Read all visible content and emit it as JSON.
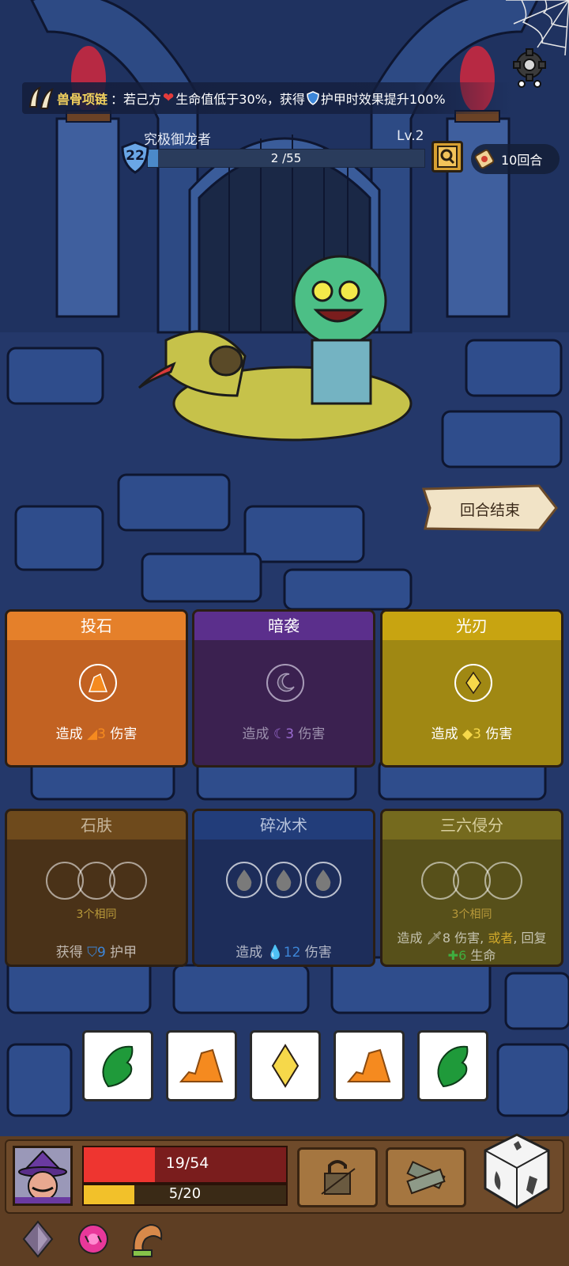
{
  "relic_banner": {
    "name": "兽骨项链",
    "sep": "：",
    "t1": "若己方",
    "t2": "生命值低于30%，获得",
    "t3": "护甲时效果提升100%"
  },
  "player": {
    "title": "究极御龙者",
    "level_label": "Lv.2",
    "level_badge": "22",
    "xp_current": "2",
    "xp_max": "/55",
    "xp_fraction": 0.036
  },
  "turns_label": "10回合",
  "end_turn_label": "回合结束",
  "cards_row1": [
    {
      "title": "投石",
      "d1": "造成 ",
      "val": "3",
      "d2": " 伤害",
      "head": "#e5802a",
      "body": "#c26222",
      "icon": "rock",
      "valcolor": "#f58a1f"
    },
    {
      "title": "暗袭",
      "d1": "造成 ",
      "val": "3",
      "d2": " 伤害",
      "head": "#5b2f8c",
      "body": "#3b2150",
      "icon": "moon",
      "valcolor": "#9a6bd0"
    },
    {
      "title": "光刃",
      "d1": "造成 ",
      "val": "3",
      "d2": " 伤害",
      "head": "#c8a411",
      "body": "#a08813",
      "icon": "diamond",
      "valcolor": "#f6d84a"
    }
  ],
  "cards_row2": {
    "stone_skin": {
      "title": "石肤",
      "same": "3个相同",
      "d1": "获得 ",
      "val": "9",
      "d2": " 护甲"
    },
    "ice_shatter": {
      "title": "碎冰术",
      "d1": "造成 ",
      "val": "12",
      "d2": " 伤害"
    },
    "three_six": {
      "title": "三六侵分",
      "same": "3个相同",
      "l1a": "造成 ",
      "l1b": "8 伤害, ",
      "or": "或者",
      "l1c": ", 回复",
      "l2a": "6",
      "l2b": " 生命"
    }
  },
  "dice": [
    "leaf",
    "rock",
    "diamond",
    "rock",
    "leaf"
  ],
  "status": {
    "hp_text": "19/54",
    "hp_fraction": 0.352,
    "energy_text": "5/20",
    "energy_fraction": 0.25
  },
  "colors": {
    "hp": "#ee3530",
    "energy": "#f2c12a",
    "xp": "#4b89c9"
  }
}
